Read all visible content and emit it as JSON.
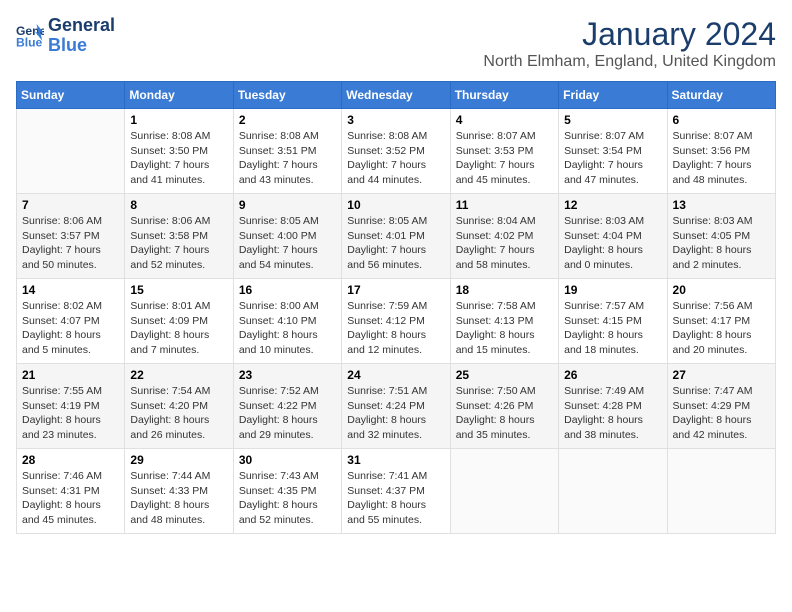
{
  "logo": {
    "line1": "General",
    "line2": "Blue"
  },
  "title": "January 2024",
  "location": "North Elmham, England, United Kingdom",
  "weekdays": [
    "Sunday",
    "Monday",
    "Tuesday",
    "Wednesday",
    "Thursday",
    "Friday",
    "Saturday"
  ],
  "weeks": [
    [
      {
        "day": "",
        "info": ""
      },
      {
        "day": "1",
        "info": "Sunrise: 8:08 AM\nSunset: 3:50 PM\nDaylight: 7 hours\nand 41 minutes."
      },
      {
        "day": "2",
        "info": "Sunrise: 8:08 AM\nSunset: 3:51 PM\nDaylight: 7 hours\nand 43 minutes."
      },
      {
        "day": "3",
        "info": "Sunrise: 8:08 AM\nSunset: 3:52 PM\nDaylight: 7 hours\nand 44 minutes."
      },
      {
        "day": "4",
        "info": "Sunrise: 8:07 AM\nSunset: 3:53 PM\nDaylight: 7 hours\nand 45 minutes."
      },
      {
        "day": "5",
        "info": "Sunrise: 8:07 AM\nSunset: 3:54 PM\nDaylight: 7 hours\nand 47 minutes."
      },
      {
        "day": "6",
        "info": "Sunrise: 8:07 AM\nSunset: 3:56 PM\nDaylight: 7 hours\nand 48 minutes."
      }
    ],
    [
      {
        "day": "7",
        "info": "Sunrise: 8:06 AM\nSunset: 3:57 PM\nDaylight: 7 hours\nand 50 minutes."
      },
      {
        "day": "8",
        "info": "Sunrise: 8:06 AM\nSunset: 3:58 PM\nDaylight: 7 hours\nand 52 minutes."
      },
      {
        "day": "9",
        "info": "Sunrise: 8:05 AM\nSunset: 4:00 PM\nDaylight: 7 hours\nand 54 minutes."
      },
      {
        "day": "10",
        "info": "Sunrise: 8:05 AM\nSunset: 4:01 PM\nDaylight: 7 hours\nand 56 minutes."
      },
      {
        "day": "11",
        "info": "Sunrise: 8:04 AM\nSunset: 4:02 PM\nDaylight: 7 hours\nand 58 minutes."
      },
      {
        "day": "12",
        "info": "Sunrise: 8:03 AM\nSunset: 4:04 PM\nDaylight: 8 hours\nand 0 minutes."
      },
      {
        "day": "13",
        "info": "Sunrise: 8:03 AM\nSunset: 4:05 PM\nDaylight: 8 hours\nand 2 minutes."
      }
    ],
    [
      {
        "day": "14",
        "info": "Sunrise: 8:02 AM\nSunset: 4:07 PM\nDaylight: 8 hours\nand 5 minutes."
      },
      {
        "day": "15",
        "info": "Sunrise: 8:01 AM\nSunset: 4:09 PM\nDaylight: 8 hours\nand 7 minutes."
      },
      {
        "day": "16",
        "info": "Sunrise: 8:00 AM\nSunset: 4:10 PM\nDaylight: 8 hours\nand 10 minutes."
      },
      {
        "day": "17",
        "info": "Sunrise: 7:59 AM\nSunset: 4:12 PM\nDaylight: 8 hours\nand 12 minutes."
      },
      {
        "day": "18",
        "info": "Sunrise: 7:58 AM\nSunset: 4:13 PM\nDaylight: 8 hours\nand 15 minutes."
      },
      {
        "day": "19",
        "info": "Sunrise: 7:57 AM\nSunset: 4:15 PM\nDaylight: 8 hours\nand 18 minutes."
      },
      {
        "day": "20",
        "info": "Sunrise: 7:56 AM\nSunset: 4:17 PM\nDaylight: 8 hours\nand 20 minutes."
      }
    ],
    [
      {
        "day": "21",
        "info": "Sunrise: 7:55 AM\nSunset: 4:19 PM\nDaylight: 8 hours\nand 23 minutes."
      },
      {
        "day": "22",
        "info": "Sunrise: 7:54 AM\nSunset: 4:20 PM\nDaylight: 8 hours\nand 26 minutes."
      },
      {
        "day": "23",
        "info": "Sunrise: 7:52 AM\nSunset: 4:22 PM\nDaylight: 8 hours\nand 29 minutes."
      },
      {
        "day": "24",
        "info": "Sunrise: 7:51 AM\nSunset: 4:24 PM\nDaylight: 8 hours\nand 32 minutes."
      },
      {
        "day": "25",
        "info": "Sunrise: 7:50 AM\nSunset: 4:26 PM\nDaylight: 8 hours\nand 35 minutes."
      },
      {
        "day": "26",
        "info": "Sunrise: 7:49 AM\nSunset: 4:28 PM\nDaylight: 8 hours\nand 38 minutes."
      },
      {
        "day": "27",
        "info": "Sunrise: 7:47 AM\nSunset: 4:29 PM\nDaylight: 8 hours\nand 42 minutes."
      }
    ],
    [
      {
        "day": "28",
        "info": "Sunrise: 7:46 AM\nSunset: 4:31 PM\nDaylight: 8 hours\nand 45 minutes."
      },
      {
        "day": "29",
        "info": "Sunrise: 7:44 AM\nSunset: 4:33 PM\nDaylight: 8 hours\nand 48 minutes."
      },
      {
        "day": "30",
        "info": "Sunrise: 7:43 AM\nSunset: 4:35 PM\nDaylight: 8 hours\nand 52 minutes."
      },
      {
        "day": "31",
        "info": "Sunrise: 7:41 AM\nSunset: 4:37 PM\nDaylight: 8 hours\nand 55 minutes."
      },
      {
        "day": "",
        "info": ""
      },
      {
        "day": "",
        "info": ""
      },
      {
        "day": "",
        "info": ""
      }
    ]
  ]
}
